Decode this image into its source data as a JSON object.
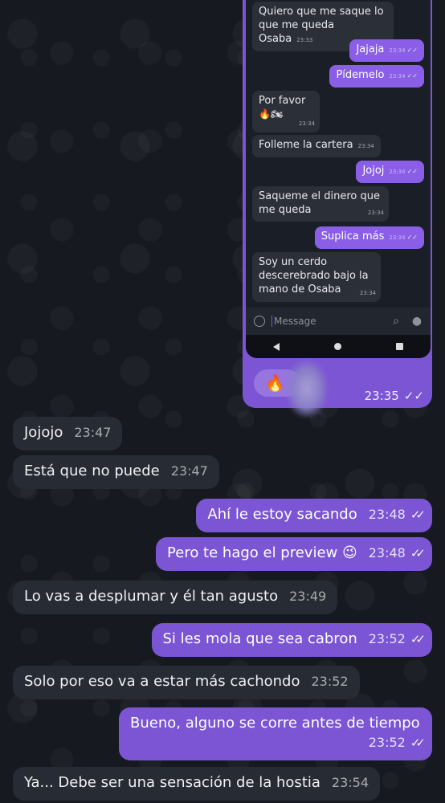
{
  "screenshot_chat": {
    "messages": [
      {
        "dir": "in",
        "text_l1": "Quiero que me saque lo",
        "text_l2": "que me queda Osaba",
        "time": "23:33"
      },
      {
        "dir": "out",
        "text": "Jajaja",
        "time": "23:34"
      },
      {
        "dir": "out",
        "text": "Pídemelo",
        "time": "23:34"
      },
      {
        "dir": "in",
        "text": "Por favor",
        "reactions": "🔥🏍",
        "time": "23:34"
      },
      {
        "dir": "in",
        "text": "Folleme la cartera",
        "time": "23:34"
      },
      {
        "dir": "out",
        "text": "Jojoj",
        "time": "23:34"
      },
      {
        "dir": "in",
        "text_l1": "Saqueme el dinero que",
        "text_l2": "me queda",
        "time": "23:34"
      },
      {
        "dir": "out",
        "text": "Suplica más",
        "time": "23:34"
      },
      {
        "dir": "in",
        "text_l1": "Soy un cerdo",
        "text_l2": "descerebrado bajo la",
        "text_l3": "mano de Osaba",
        "time": "23:34"
      }
    ],
    "composer_placeholder": "Message"
  },
  "screenshot_message": {
    "reaction": "🔥",
    "time": "23:35",
    "check": "✓✓"
  },
  "messages": [
    {
      "dir": "in",
      "text": "Jojojo",
      "time": "23:47"
    },
    {
      "dir": "in",
      "text": "Está que no puede",
      "time": "23:47"
    },
    {
      "dir": "out",
      "text": "Ahí le estoy sacando",
      "time": "23:48",
      "check": "✓✓"
    },
    {
      "dir": "out",
      "text": "Pero te hago el preview 😉",
      "time": "23:48",
      "check": "✓✓"
    },
    {
      "dir": "in",
      "text": "Lo vas a desplumar y él tan agusto",
      "time": "23:49"
    },
    {
      "dir": "out",
      "text": "Si les mola que sea cabron",
      "time": "23:52",
      "check": "✓✓"
    },
    {
      "dir": "in",
      "text": "Solo por eso va a estar más cachondo",
      "time": "23:52"
    },
    {
      "dir": "out",
      "text": "Bueno, alguno se corre antes de tiempo",
      "time": "23:52",
      "check": "✓✓"
    },
    {
      "dir": "in",
      "text": "Ya... Debe ser una sensación de la hostia",
      "time": "23:54"
    }
  ],
  "colors": {
    "outgoing": "#7b55d3",
    "incoming": "#272b33",
    "background": "#161a20"
  }
}
